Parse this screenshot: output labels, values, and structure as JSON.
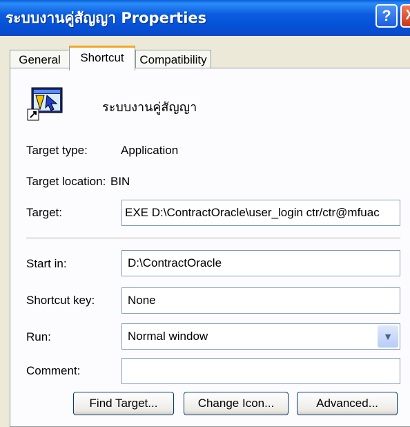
{
  "window": {
    "title": "ระบบงานคู่สัญญา Properties",
    "help_label": "?",
    "close_label": "X"
  },
  "tabs": [
    {
      "label": "General",
      "active": false
    },
    {
      "label": "Shortcut",
      "active": true
    },
    {
      "label": "Compatibility",
      "active": false
    }
  ],
  "shortcut": {
    "icon": "app-shortcut-icon",
    "name": "ระบบงานคู่สัญญา"
  },
  "info": {
    "target_type_label": "Target type:",
    "target_type_value": "Application",
    "target_location_label": "Target location:",
    "target_location_value": "BIN"
  },
  "fields": {
    "target_label": "Target:",
    "target_value": "EXE D:\\ContractOracle\\user_login ctr/ctr@mfuac",
    "start_in_label": "Start in:",
    "start_in_value": "D:\\ContractOracle",
    "shortcut_key_label": "Shortcut key:",
    "shortcut_key_value": "None",
    "run_label": "Run:",
    "run_value": "Normal window",
    "comment_label": "Comment:",
    "comment_value": ""
  },
  "buttons": {
    "find_target": "Find Target...",
    "change_icon": "Change Icon...",
    "advanced": "Advanced..."
  },
  "colors": {
    "titlebar": "#0550d6",
    "dialog_bg": "#ece9d8",
    "panel_bg": "#fcfcfe",
    "tab_accent": "#f5a623",
    "close_button": "#c8361a"
  }
}
